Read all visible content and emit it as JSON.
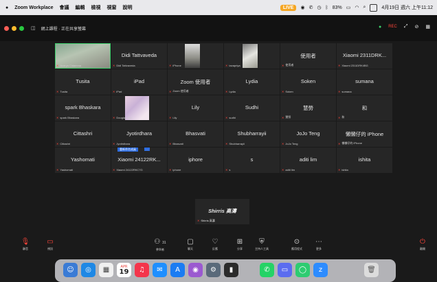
{
  "menubar": {
    "app_name": "Zoom Workplace",
    "menus": [
      "會議",
      "編輯",
      "檢視",
      "視窗",
      "說明"
    ],
    "right_badge": "LIVE",
    "battery": "83%",
    "datetime": "4月19日 週六 上午11:12"
  },
  "window": {
    "title": "網上課程 · 正在共享螢幕",
    "rec_label": "REC"
  },
  "participants": [
    {
      "big": "",
      "small": "Acarya Cidamma",
      "media": "video"
    },
    {
      "big": "Didi Tattvaveda",
      "small": "Didi Tattvaveda",
      "media": ""
    },
    {
      "big": "",
      "small": "iPhone",
      "media": "photo1"
    },
    {
      "big": "",
      "small": "tavapriya",
      "media": "photo2"
    },
    {
      "big": "使用者",
      "small": "使用者",
      "media": ""
    },
    {
      "big": "Xiaomi 2311DRK...",
      "small": "Xiaomi 2311DRK4BG",
      "media": ""
    },
    {
      "big": "Tusita",
      "small": "Tusita",
      "media": ""
    },
    {
      "big": "iPad",
      "small": "iPad",
      "media": ""
    },
    {
      "big": "Zoom 使用者",
      "small": "Zoom 使用者",
      "media": ""
    },
    {
      "big": "Lydia",
      "small": "Lydia",
      "media": ""
    },
    {
      "big": "Soken",
      "small": "Soken",
      "media": ""
    },
    {
      "big": "sumana",
      "small": "sumana",
      "media": ""
    },
    {
      "big": "spark Bhaskara",
      "small": "spark Bhaskara",
      "media": ""
    },
    {
      "big": "",
      "small": "Douglas Tao",
      "media": "photo3"
    },
    {
      "big": "Lily",
      "small": "Lily",
      "media": ""
    },
    {
      "big": "Sudhi",
      "small": "sudhi",
      "media": ""
    },
    {
      "big": "慧勞",
      "small": "慧勞",
      "media": ""
    },
    {
      "big": "和",
      "small": "和",
      "media": ""
    },
    {
      "big": "Cittashri",
      "small": "Cittashri",
      "media": ""
    },
    {
      "big": "Jyotirdhara",
      "small": "Jyotirdhara",
      "media": ""
    },
    {
      "big": "Bhasvati",
      "small": "Bhasvati",
      "media": ""
    },
    {
      "big": "Shubharrayii",
      "small": "Shubharrayii",
      "media": ""
    },
    {
      "big": "JoJo Teng",
      "small": "JoJo Teng",
      "media": ""
    },
    {
      "big": "懶懶仔的 iPhone",
      "small": "懶懶仔的 iPhone",
      "media": ""
    },
    {
      "big": "Yashomati",
      "small": "Yashomati",
      "media": ""
    },
    {
      "big": "Xiaomi 24122RK...",
      "small": "Xiaomi 24122RKC7G",
      "media": ""
    },
    {
      "big": "iphore",
      "small": "iphone",
      "media": ""
    },
    {
      "big": "s",
      "small": "s",
      "media": ""
    },
    {
      "big": "aditi lim",
      "small": "aditi lim",
      "media": ""
    },
    {
      "big": "ishita",
      "small": "ishita",
      "media": ""
    }
  ],
  "blue_tag": "重新命名成員",
  "blue_dots": "…",
  "extra_tile": {
    "big": "Shirris 高濤",
    "small": "Shirris 高濤"
  },
  "toolbar": {
    "audio": "靜音",
    "video": "視訊",
    "participants": "參與者",
    "participants_count": "31",
    "chat": "聊天",
    "react": "反應",
    "share": "分享",
    "apps": "應用程式",
    "host_tools": "主持人工具",
    "more": "更多",
    "end": "離開"
  },
  "dock": {
    "calendar_day": "19",
    "calendar_month": "APR"
  },
  "colors": {
    "active_speaker": "#3bd06a",
    "muted": "#ff453a",
    "accent": "#2d6cdf"
  }
}
